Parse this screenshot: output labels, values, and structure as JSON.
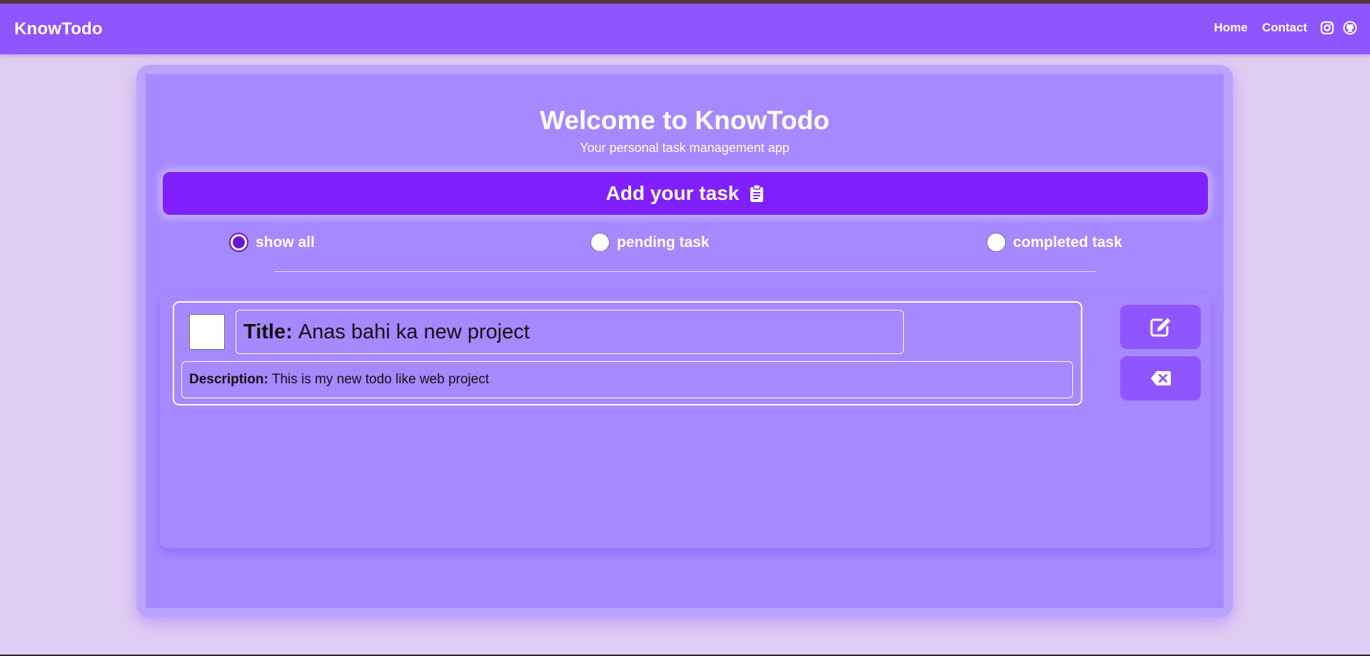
{
  "navbar": {
    "brand": "KnowTodo",
    "links": [
      "Home",
      "Contact"
    ],
    "icons": [
      "instagram-icon",
      "github-icon"
    ]
  },
  "hero": {
    "title": "Welcome to KnowTodo",
    "subtitle": "Your personal task management app"
  },
  "add_task": {
    "label": "Add your task",
    "icon": "clipboard-icon"
  },
  "filters": [
    {
      "label": "show all",
      "checked": true
    },
    {
      "label": "pending task",
      "checked": false
    },
    {
      "label": "completed task",
      "checked": false
    }
  ],
  "todos": [
    {
      "title_label": "Title:",
      "title": "Anas bahi ka new project",
      "description_label": "Description:",
      "description": "This is my new todo like web project",
      "completed": false
    }
  ],
  "actions": {
    "edit_icon": "edit-icon",
    "delete_icon": "delete-icon"
  },
  "colors": {
    "navbar": "#8f55ff",
    "page_background": "#e0cdf2",
    "card_background": "#a688ff",
    "primary_button": "#8020ff",
    "action_button": "#8f55ff"
  }
}
